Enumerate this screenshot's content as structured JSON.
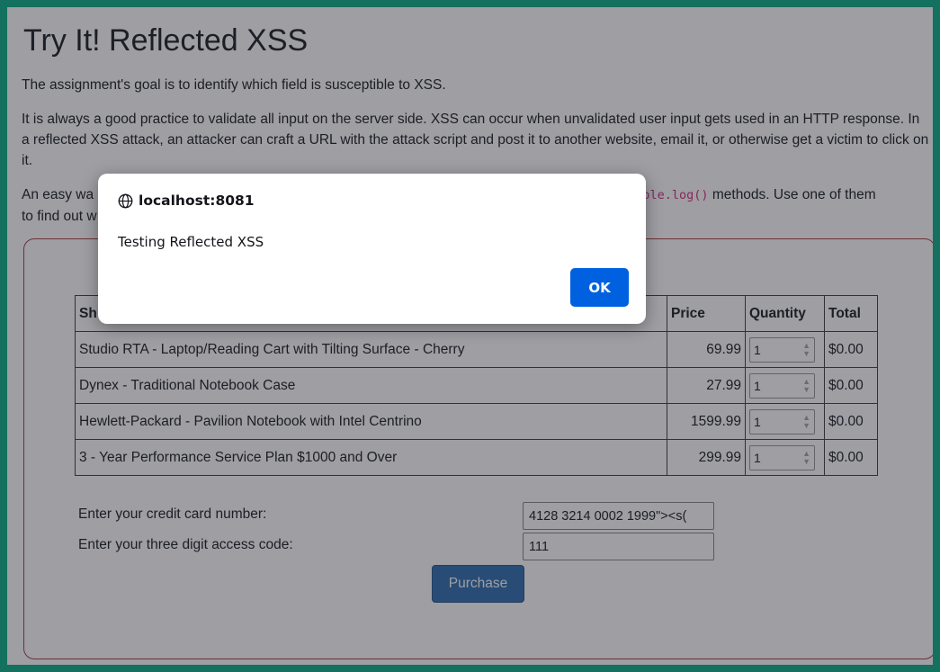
{
  "page": {
    "title": "Try It! Reflected XSS",
    "para1": "The assignment's goal is to identify which field is susceptible to XSS.",
    "para2": "It is always a good practice to validate all input on the server side. XSS can occur when unvalidated user input gets used in an HTTP response. In a reflected XSS attack, an attacker can craft a URL with the attack script and post it to another website, email it, or otherwise get a victim to click on it.",
    "para3_start": "An easy wa",
    "para3_code": "nsole.log()",
    "para3_end": " methods. Use one of them",
    "para3_line2": "to find out w"
  },
  "cart": {
    "headers": {
      "name": "Sh",
      "price": "Price",
      "quantity": "Quantity",
      "total": "Total"
    },
    "rows": [
      {
        "name": "Studio RTA - Laptop/Reading Cart with Tilting Surface - Cherry",
        "price": "69.99",
        "qty": "1",
        "total": "$0.00"
      },
      {
        "name": "Dynex - Traditional Notebook Case",
        "price": "27.99",
        "qty": "1",
        "total": "$0.00"
      },
      {
        "name": "Hewlett-Packard - Pavilion Notebook with Intel Centrino",
        "price": "1599.99",
        "qty": "1",
        "total": "$0.00"
      },
      {
        "name": "3 - Year Performance Service Plan $1000 and Over",
        "price": "299.99",
        "qty": "1",
        "total": "$0.00"
      }
    ]
  },
  "form": {
    "cc_label": "Enter your credit card number:",
    "cc_value": "4128 3214 0002 1999\"><s(",
    "code_label": "Enter your three digit access code:",
    "code_value": "111",
    "purchase_label": "Purchase"
  },
  "dialog": {
    "origin": "localhost:8081",
    "message": "Testing Reflected XSS",
    "ok_label": "OK"
  },
  "colors": {
    "frame": "#12b08a",
    "ok_button": "#0061e0",
    "purchase_button": "#3572b0",
    "card_border": "#a94442"
  },
  "icons": {
    "origin": "globe-icon",
    "spinner": "spinner-arrows-icon"
  }
}
